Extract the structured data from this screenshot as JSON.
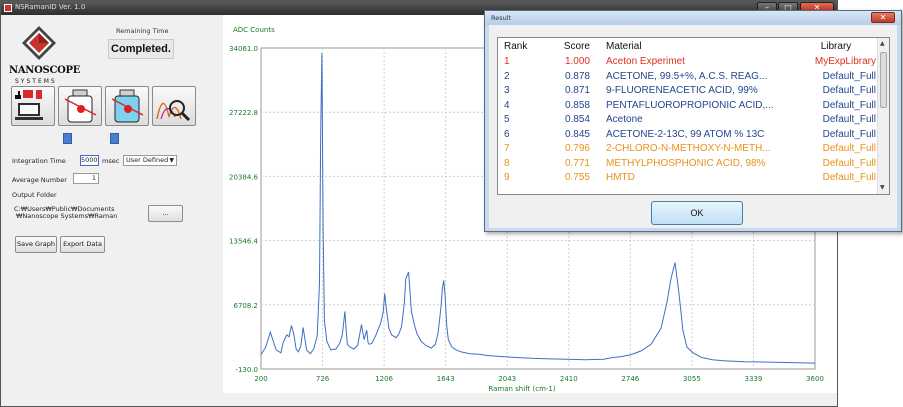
{
  "main_window": {
    "title": "NSRamanID Ver. 1.0",
    "controls": {
      "minimize": "–",
      "maximize": "□",
      "close": "✕"
    }
  },
  "logo": {
    "brand": "NANOSCOPE",
    "sub": "SYSTEMS",
    "icon": "nanoscope-logo-icon"
  },
  "status": {
    "label": "Remaining Time",
    "value": "Completed."
  },
  "toolbar": {
    "buttons": [
      {
        "icon": "device-connect-icon"
      },
      {
        "icon": "sample-bottle-icon"
      },
      {
        "icon": "reference-bottle-icon"
      },
      {
        "icon": "spectrum-search-icon"
      }
    ],
    "doc_icons": [
      "document-icon",
      "document-icon"
    ]
  },
  "settings": {
    "integration_time_label": "Integration Time",
    "integration_time_value": "5000",
    "integration_time_unit": "msec",
    "mode_value": "User Defined",
    "average_number_label": "Average Number",
    "average_number_value": "1",
    "output_folder_label": "Output Folder",
    "output_folder_line1": "C:₩Users₩Public₩Documents",
    "output_folder_line2": "₩Nanoscope Systems₩Raman",
    "browse_label": "...",
    "save_graph_label": "Save Graph",
    "export_data_label": "Export Data"
  },
  "chart_data": {
    "type": "line",
    "ylabel": "ADC Counts",
    "xlabel": "Raman shift (cm-1)",
    "xlim": [
      200,
      3600
    ],
    "ylim": [
      -130,
      34061
    ],
    "x_ticks": [
      "200",
      "726",
      "1206",
      "1643",
      "2043",
      "2410",
      "2746",
      "3055",
      "3339",
      "3600"
    ],
    "y_ticks": [
      "34061.0",
      "27222.8",
      "20384.6",
      "13546.4",
      "6708.2",
      "-130.0"
    ],
    "grid": true,
    "series_color": "#3d6fc4",
    "series": [
      {
        "x": [
          200,
          240,
          280,
          300,
          330,
          370,
          390,
          420,
          440,
          460,
          480,
          500,
          520,
          540,
          560,
          590,
          620,
          650,
          680,
          700,
          710,
          720,
          730,
          740,
          760,
          790,
          830,
          860,
          880,
          900,
          910,
          920,
          940,
          970,
          1000,
          1030,
          1050,
          1070,
          1080,
          1090,
          1110,
          1140,
          1180,
          1200,
          1210,
          1220,
          1240,
          1260,
          1290,
          1310,
          1330,
          1350,
          1360,
          1380,
          1400,
          1420,
          1440,
          1470,
          1500,
          1540,
          1570,
          1590,
          1610,
          1620,
          1630,
          1640,
          1650,
          1660,
          1680,
          1700,
          1740,
          1800,
          1860,
          1920,
          2000,
          2100,
          2200,
          2300,
          2400,
          2500,
          2600,
          2650,
          2700,
          2750,
          2800,
          2850,
          2900,
          2930,
          2950,
          2970,
          2990,
          3010,
          3030,
          3060,
          3100,
          3150,
          3200,
          3300,
          3400,
          3500,
          3600
        ],
        "values": [
          1400,
          2200,
          3800,
          3000,
          1900,
          1600,
          2700,
          3500,
          3300,
          4500,
          3600,
          2000,
          1700,
          2300,
          4300,
          1900,
          1500,
          2000,
          3400,
          9000,
          25000,
          33500,
          15000,
          5000,
          2800,
          1900,
          2000,
          2600,
          3500,
          6000,
          4000,
          2500,
          2200,
          2000,
          2400,
          4600,
          3000,
          4000,
          2700,
          2500,
          2600,
          3400,
          4800,
          6000,
          7900,
          6500,
          4200,
          3500,
          3200,
          3600,
          4400,
          7000,
          9500,
          10200,
          6000,
          4600,
          3600,
          2800,
          2400,
          2100,
          2500,
          3800,
          6500,
          8500,
          9300,
          7500,
          4500,
          3000,
          2300,
          2000,
          1700,
          1500,
          1450,
          1300,
          1200,
          1100,
          1000,
          950,
          900,
          850,
          900,
          1100,
          1200,
          1400,
          1800,
          2500,
          4200,
          7000,
          9500,
          11200,
          8000,
          4000,
          2200,
          1600,
          1100,
          850,
          750,
          650,
          600,
          550,
          500
        ]
      }
    ]
  },
  "result_dialog": {
    "title": "Result",
    "close": "✕",
    "columns": [
      "Rank",
      "Score",
      "Material",
      "Library"
    ],
    "rows": [
      {
        "rank": "1",
        "score": "1.000",
        "material": "Aceton Experimet",
        "library": "MyExpLibrary",
        "color": "#e0301e"
      },
      {
        "rank": "2",
        "score": "0.878",
        "material": "ACETONE, 99.5+%, A.C.S. REAG...",
        "library": "Default_Full",
        "color": "#23468f"
      },
      {
        "rank": "3",
        "score": "0.871",
        "material": "9-FLUORENEACETIC ACID, 99%",
        "library": "Default_Full",
        "color": "#23468f"
      },
      {
        "rank": "4",
        "score": "0.858",
        "material": "PENTAFLUOROPROPIONIC ACID,...",
        "library": "Default_Full",
        "color": "#23468f"
      },
      {
        "rank": "5",
        "score": "0.854",
        "material": "Acetone",
        "library": "Default_Full",
        "color": "#23468f"
      },
      {
        "rank": "6",
        "score": "0.845",
        "material": "ACETONE-2-13C, 99 ATOM % 13C",
        "library": "Default_Full",
        "color": "#23468f"
      },
      {
        "rank": "7",
        "score": "0.796",
        "material": "2-CHLORO-N-METHOXY-N-METH...",
        "library": "Default_Full",
        "color": "#e8921a"
      },
      {
        "rank": "8",
        "score": "0.771",
        "material": "METHYLPHOSPHONIC ACID, 98%",
        "library": "Default_Full",
        "color": "#e8921a"
      },
      {
        "rank": "9",
        "score": "0.755",
        "material": "HMTD",
        "library": "Default_Full",
        "color": "#e8921a"
      }
    ],
    "ok_label": "OK"
  }
}
